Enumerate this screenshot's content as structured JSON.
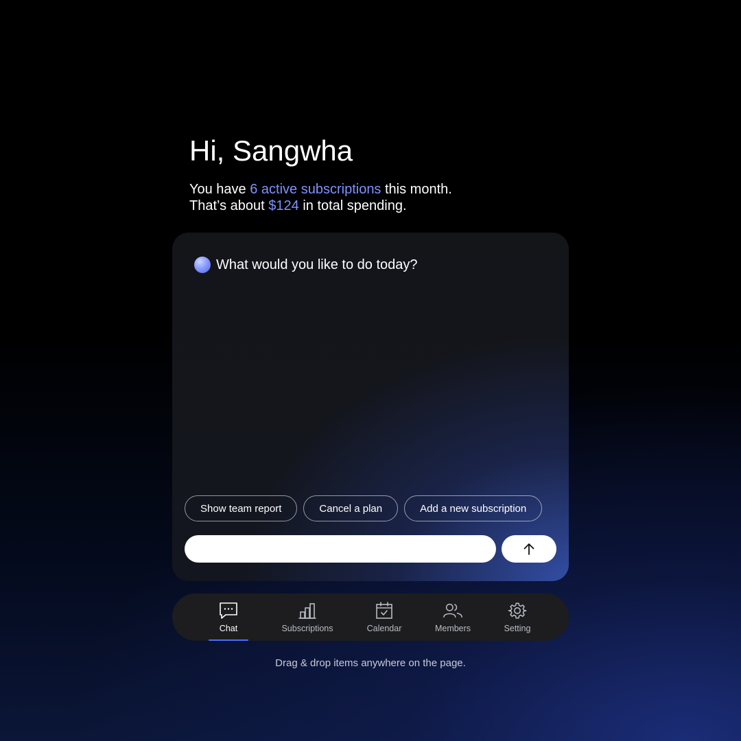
{
  "greeting": {
    "title": "Hi, Sangwha",
    "line1_prefix": "You have ",
    "line1_highlight": "6 active subscriptions",
    "line1_suffix": " this month.",
    "line2_prefix": "That’s about ",
    "line2_highlight": "$124",
    "line2_suffix": " in total spending."
  },
  "chat": {
    "prompt": "What would you like to do today?",
    "suggestions": [
      "Show team report",
      "Cancel a plan",
      "Add a new subscription"
    ],
    "input_value": "",
    "send_icon": "arrow-up-icon"
  },
  "nav": {
    "active": "Chat",
    "items": [
      {
        "label": "Chat",
        "icon": "chat-bubble-icon"
      },
      {
        "label": "Subscriptions",
        "icon": "bar-chart-icon"
      },
      {
        "label": "Calendar",
        "icon": "calendar-icon"
      },
      {
        "label": "Members",
        "icon": "members-icon"
      },
      {
        "label": "Setting",
        "icon": "gear-icon"
      }
    ]
  },
  "footer": {
    "hint": "Drag & drop items anywhere on the page."
  },
  "colors": {
    "accent": "#7e93ff",
    "nav_active_underline": "#4f6dff"
  }
}
